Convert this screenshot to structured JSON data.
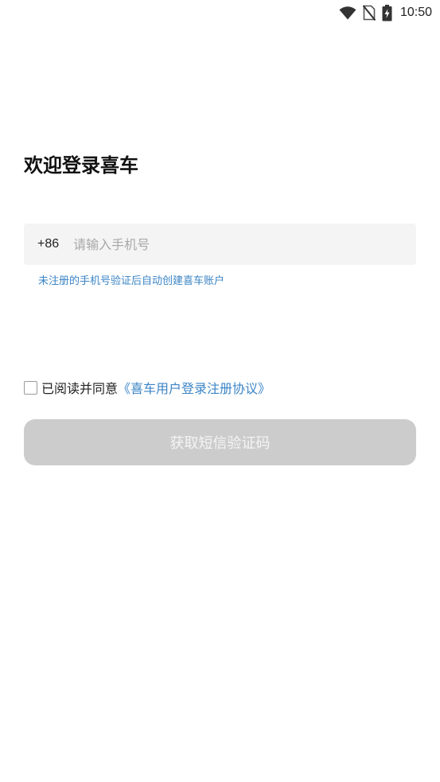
{
  "status_bar": {
    "time": "10:50",
    "icons": [
      "wifi-icon",
      "no-sim-icon",
      "battery-charging-icon"
    ]
  },
  "login": {
    "title": "欢迎登录喜车",
    "country_code": "+86",
    "phone_placeholder": "请输入手机号",
    "phone_value": "",
    "hint": "未注册的手机号验证后自动创建喜车账户",
    "agree_prefix": "已阅读并同意",
    "agreement_link": "《喜车用户登录注册协议》",
    "agreement_checked": false,
    "submit_label": "获取短信验证码",
    "submit_enabled": false
  },
  "colors": {
    "accent": "#3b84c6",
    "button_disabled_bg": "#cccccc",
    "button_disabled_text": "#f4f4f4",
    "input_bg": "#f4f4f4",
    "placeholder": "#a8a8a8"
  }
}
